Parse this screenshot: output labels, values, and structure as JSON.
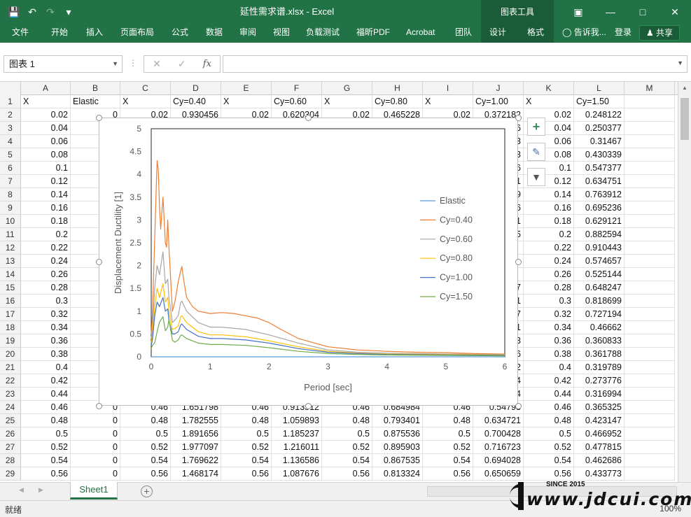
{
  "window": {
    "doc_title": "延性需求谱.xlsx - Excel",
    "context_tab_group": "图表工具",
    "controls": [
      "ribbon-display-icon",
      "minimize-icon",
      "maximize-icon",
      "close-icon"
    ]
  },
  "ribbon": {
    "tabs": [
      "文件",
      "开始",
      "插入",
      "页面布局",
      "公式",
      "数据",
      "审阅",
      "视图",
      "负载测试",
      "福昕PDF",
      "Acrobat",
      "团队"
    ],
    "context_tabs": [
      "设计",
      "格式"
    ],
    "tell_me": "告诉我...",
    "login": "登录",
    "share": "共享"
  },
  "formula_bar": {
    "name_box": "图表 1",
    "fx_label": "fx",
    "formula": ""
  },
  "grid": {
    "columns": [
      "A",
      "B",
      "C",
      "D",
      "E",
      "F",
      "G",
      "H",
      "I",
      "J",
      "K",
      "L",
      "M"
    ],
    "header_row": [
      "X",
      "Elastic",
      "X",
      "Cy=0.40",
      "X",
      "Cy=0.60",
      "X",
      "Cy=0.80",
      "X",
      "Cy=1.00",
      "X",
      "Cy=1.50",
      ""
    ],
    "row_numbers": [
      "1",
      "2",
      "3",
      "4",
      "5",
      "6",
      "7",
      "8",
      "9",
      "10",
      "11",
      "12",
      "13",
      "14",
      "15",
      "16",
      "17",
      "18",
      "19",
      "20",
      "21",
      "22",
      "23",
      "24",
      "25",
      "26",
      "27",
      "28",
      "29"
    ],
    "col_a": [
      "0.02",
      "0.04",
      "0.06",
      "0.08",
      "0.1",
      "0.12",
      "0.14",
      "0.16",
      "0.18",
      "0.2",
      "0.22",
      "0.24",
      "0.26",
      "0.28",
      "0.3",
      "0.32",
      "0.34",
      "0.36",
      "0.38",
      "0.4",
      "0.42",
      "0.44",
      "0.46",
      "0.48",
      "0.5",
      "0.52",
      "0.54",
      "0.56"
    ],
    "col_k": [
      "0.02",
      "0.04",
      "0.06",
      "0.08",
      "0.1",
      "0.12",
      "0.14",
      "0.16",
      "0.18",
      "0.2",
      "0.22",
      "0.24",
      "0.26",
      "0.28",
      "0.3",
      "0.32",
      "0.34",
      "0.36",
      "0.38",
      "0.4",
      "0.42",
      "0.44",
      "0.46",
      "0.48",
      "0.5",
      "0.52",
      "0.54",
      "0.56"
    ],
    "col_l": [
      "0.248122",
      "0.250377",
      "0.31467",
      "0.430339",
      "0.547377",
      "0.634751",
      "0.763912",
      "0.695236",
      "0.629121",
      "0.882594",
      "0.910443",
      "0.574657",
      "0.525144",
      "0.648247",
      "0.818699",
      "0.727194",
      "0.46662",
      "0.360833",
      "0.361788",
      "0.319789",
      "0.273776",
      "0.316994",
      "0.365325",
      "0.423147",
      "0.466952",
      "0.477815",
      "0.462686",
      "0.433773"
    ],
    "row2_partial": {
      "C": "0.02",
      "D": "0.930456",
      "E": "0.02",
      "F": "0.620304",
      "G": "0.02",
      "H": "0.465228",
      "I": "0.02",
      "J": "0.372182"
    },
    "bottom_rows": [
      {
        "row": "24",
        "B": "0",
        "C": "0.46",
        "D": "1.651798",
        "E": "0.46",
        "F": "0.913512",
        "G": "0.46",
        "H": "0.684984",
        "I": "0.46",
        "J": "0.54798"
      },
      {
        "row": "25",
        "B": "0",
        "C": "0.48",
        "D": "1.782555",
        "E": "0.48",
        "F": "1.059893",
        "G": "0.48",
        "H": "0.793401",
        "I": "0.48",
        "J": "0.634721"
      },
      {
        "row": "26",
        "B": "0",
        "C": "0.5",
        "D": "1.891656",
        "E": "0.5",
        "F": "1.185237",
        "G": "0.5",
        "H": "0.875536",
        "I": "0.5",
        "J": "0.700428"
      },
      {
        "row": "27",
        "B": "0",
        "C": "0.52",
        "D": "1.977097",
        "E": "0.52",
        "F": "1.216011",
        "G": "0.52",
        "H": "0.895903",
        "I": "0.52",
        "J": "0.716723"
      },
      {
        "row": "28",
        "B": "0",
        "C": "0.54",
        "D": "1.769622",
        "E": "0.54",
        "F": "1.136586",
        "G": "0.54",
        "H": "0.867535",
        "I": "0.54",
        "J": "0.694028"
      },
      {
        "row": "29",
        "B": "0",
        "C": "0.56",
        "D": "1.468174",
        "E": "0.56",
        "F": "1.087676",
        "G": "0.56",
        "H": "0.813324",
        "I": "0.56",
        "J": "0.650659"
      }
    ],
    "j_visible_digits": [
      "6",
      "3",
      "3",
      "6",
      "1",
      "9",
      "6",
      "1",
      "5",
      "",
      "",
      "",
      "7",
      "1",
      "7",
      "1",
      "3",
      "6",
      "2",
      "4",
      "4",
      "4"
    ]
  },
  "chart_data": {
    "type": "line",
    "title": "",
    "xlabel": "Period [sec]",
    "ylabel": "Displacement Ductility [1]",
    "xlim": [
      0,
      6
    ],
    "ylim": [
      0,
      5
    ],
    "xticks": [
      "0",
      "1",
      "2",
      "3",
      "4",
      "5",
      "6"
    ],
    "yticks": [
      "0",
      "0.5",
      "1",
      "1.5",
      "2",
      "2.5",
      "3",
      "3.5",
      "4",
      "4.5",
      "5"
    ],
    "grid": false,
    "legend_position": "right",
    "series": [
      {
        "name": "Elastic",
        "color": "#5b9bd5",
        "x": [
          0,
          6
        ],
        "y": [
          0,
          0
        ]
      },
      {
        "name": "Cy=0.40",
        "color": "#ed7d31",
        "x": [
          0,
          0.02,
          0.06,
          0.1,
          0.12,
          0.14,
          0.16,
          0.2,
          0.22,
          0.24,
          0.26,
          0.28,
          0.3,
          0.36,
          0.4,
          0.46,
          0.5,
          0.52,
          0.54,
          0.6,
          0.7,
          0.8,
          1.0,
          1.2,
          1.4,
          1.6,
          1.8,
          2.0,
          2.2,
          2.5,
          3.0,
          3.5,
          4.0,
          4.5,
          5.0,
          5.5,
          6.0
        ],
        "y": [
          0.5,
          0.93,
          2.6,
          4.3,
          4.1,
          3.3,
          2.8,
          3.5,
          3.0,
          2.5,
          2.4,
          3.0,
          2.4,
          1.0,
          1.2,
          1.65,
          1.89,
          1.98,
          1.77,
          1.3,
          1.1,
          1.0,
          0.95,
          0.97,
          0.95,
          0.9,
          0.85,
          0.75,
          0.6,
          0.4,
          0.22,
          0.15,
          0.12,
          0.1,
          0.09,
          0.07,
          0.06
        ]
      },
      {
        "name": "Cy=0.60",
        "color": "#a5a5a5",
        "x": [
          0,
          0.02,
          0.06,
          0.1,
          0.14,
          0.2,
          0.24,
          0.28,
          0.3,
          0.36,
          0.4,
          0.46,
          0.5,
          0.52,
          0.6,
          0.8,
          1.0,
          1.2,
          1.6,
          2.0,
          2.5,
          3.0,
          3.5,
          4.0,
          5.0,
          6.0
        ],
        "y": [
          0.4,
          0.62,
          1.5,
          2.0,
          1.8,
          2.3,
          1.6,
          1.7,
          1.3,
          0.75,
          0.8,
          0.91,
          1.19,
          1.22,
          1.0,
          0.75,
          0.65,
          0.65,
          0.6,
          0.48,
          0.3,
          0.15,
          0.1,
          0.08,
          0.06,
          0.05
        ]
      },
      {
        "name": "Cy=0.80",
        "color": "#ffc000",
        "x": [
          0,
          0.02,
          0.06,
          0.1,
          0.14,
          0.2,
          0.24,
          0.28,
          0.3,
          0.36,
          0.4,
          0.46,
          0.5,
          0.52,
          0.6,
          0.8,
          1.0,
          1.2,
          1.6,
          2.0,
          2.5,
          3.0,
          3.5,
          4.0,
          5.0,
          6.0
        ],
        "y": [
          0.3,
          0.47,
          1.1,
          1.5,
          1.3,
          1.6,
          1.2,
          1.3,
          1.0,
          0.6,
          0.62,
          0.68,
          0.88,
          0.9,
          0.75,
          0.55,
          0.48,
          0.48,
          0.44,
          0.35,
          0.22,
          0.12,
          0.08,
          0.06,
          0.05,
          0.04
        ]
      },
      {
        "name": "Cy=1.00",
        "color": "#4472c4",
        "x": [
          0,
          0.02,
          0.06,
          0.1,
          0.14,
          0.2,
          0.24,
          0.28,
          0.3,
          0.36,
          0.4,
          0.46,
          0.5,
          0.52,
          0.6,
          0.8,
          1.0,
          1.2,
          1.6,
          2.0,
          2.5,
          3.0,
          3.5,
          4.0,
          5.0,
          6.0
        ],
        "y": [
          0.25,
          0.37,
          0.9,
          1.2,
          1.1,
          1.3,
          1.0,
          1.05,
          0.8,
          0.5,
          0.5,
          0.55,
          0.7,
          0.72,
          0.6,
          0.45,
          0.4,
          0.4,
          0.37,
          0.3,
          0.18,
          0.1,
          0.07,
          0.05,
          0.04,
          0.03
        ]
      },
      {
        "name": "Cy=1.50",
        "color": "#70ad47",
        "x": [
          0,
          0.02,
          0.06,
          0.1,
          0.14,
          0.2,
          0.24,
          0.28,
          0.3,
          0.36,
          0.4,
          0.46,
          0.5,
          0.52,
          0.6,
          0.8,
          1.0,
          1.2,
          1.6,
          2.0,
          2.5,
          3.0,
          3.5,
          4.0,
          5.0,
          6.0
        ],
        "y": [
          0.18,
          0.25,
          0.31,
          0.55,
          0.76,
          0.88,
          0.57,
          0.65,
          0.82,
          0.36,
          0.32,
          0.37,
          0.47,
          0.48,
          0.4,
          0.3,
          0.27,
          0.27,
          0.25,
          0.2,
          0.12,
          0.07,
          0.05,
          0.04,
          0.03,
          0.02
        ]
      }
    ]
  },
  "chart_side_buttons": [
    "chart-elements-icon",
    "chart-styles-icon",
    "chart-filters-icon"
  ],
  "sheets": {
    "tabs": [
      "Sheet1"
    ],
    "add_symbol": "+"
  },
  "status": {
    "text": "就绪",
    "zoom": "100%"
  },
  "watermark": {
    "since": "SINCE 2015",
    "site": "www.jdcui.com"
  }
}
